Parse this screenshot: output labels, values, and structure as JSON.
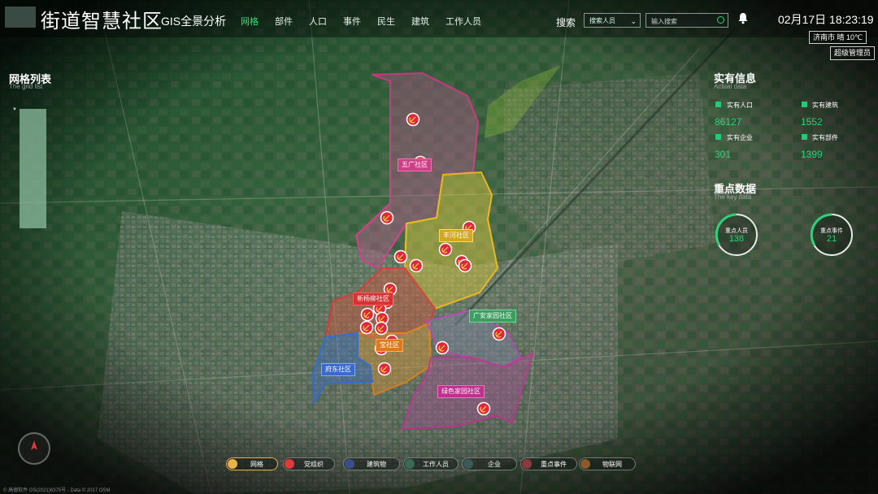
{
  "app": {
    "title": "街道智慧社区",
    "subtitle": "GIS全景分析"
  },
  "nav": [
    {
      "label": "网格",
      "active": true
    },
    {
      "label": "部件",
      "active": false
    },
    {
      "label": "人口",
      "active": false
    },
    {
      "label": "事件",
      "active": false
    },
    {
      "label": "民生",
      "active": false
    },
    {
      "label": "建筑",
      "active": false
    },
    {
      "label": "工作人员",
      "active": false
    }
  ],
  "search": {
    "label": "搜索",
    "type_value": "搜索人员",
    "placeholder": "输入搜索"
  },
  "datetime": "02月17日 18:23:19",
  "weather": "济南市  晴  10℃",
  "user_role": "超级管理员",
  "grid_list": {
    "title": "网格列表",
    "subtitle": "The grid list"
  },
  "actual": {
    "title": "实有信息",
    "subtitle": "Actual data",
    "stats": [
      {
        "label": "实有人口",
        "value": "86127"
      },
      {
        "label": "实有建筑",
        "value": "1552"
      },
      {
        "label": "实有企业",
        "value": "301"
      },
      {
        "label": "实有部件",
        "value": "1399"
      }
    ]
  },
  "key_data": {
    "title": "重点数据",
    "subtitle": "The key data",
    "gauges": [
      {
        "label": "重点人员",
        "value": "138"
      },
      {
        "label": "重点事件",
        "value": "21"
      }
    ]
  },
  "districts": [
    {
      "label": "五广社区"
    },
    {
      "label": "丰河社区"
    },
    {
      "label": "新杨柳社区"
    },
    {
      "label": "广安家园社区"
    },
    {
      "label": "宝社区"
    },
    {
      "label": "府东社区"
    },
    {
      "label": "绿色家园社区"
    }
  ],
  "layers": [
    {
      "label": "网格",
      "active": true,
      "color": "#e6b24a"
    },
    {
      "label": "党组织",
      "active": false,
      "color": "#e03a3a"
    },
    {
      "label": "建筑物",
      "active": false,
      "color": "#3a4f8a"
    },
    {
      "label": "工作人员",
      "active": false,
      "color": "#3a6a55"
    },
    {
      "label": "企业",
      "active": false,
      "color": "#3a5a55"
    },
    {
      "label": "重点事件",
      "active": false,
      "color": "#8a3a3a"
    },
    {
      "label": "物联网",
      "active": false,
      "color": "#8a5a2a"
    }
  ],
  "icons": {
    "bell": "bell-icon",
    "search": "search-icon",
    "compass": "compass-icon",
    "party": "party-emblem-icon"
  },
  "copyright": "© 高德软件 GS(2021)6375号 - Data © 2017 OSM"
}
